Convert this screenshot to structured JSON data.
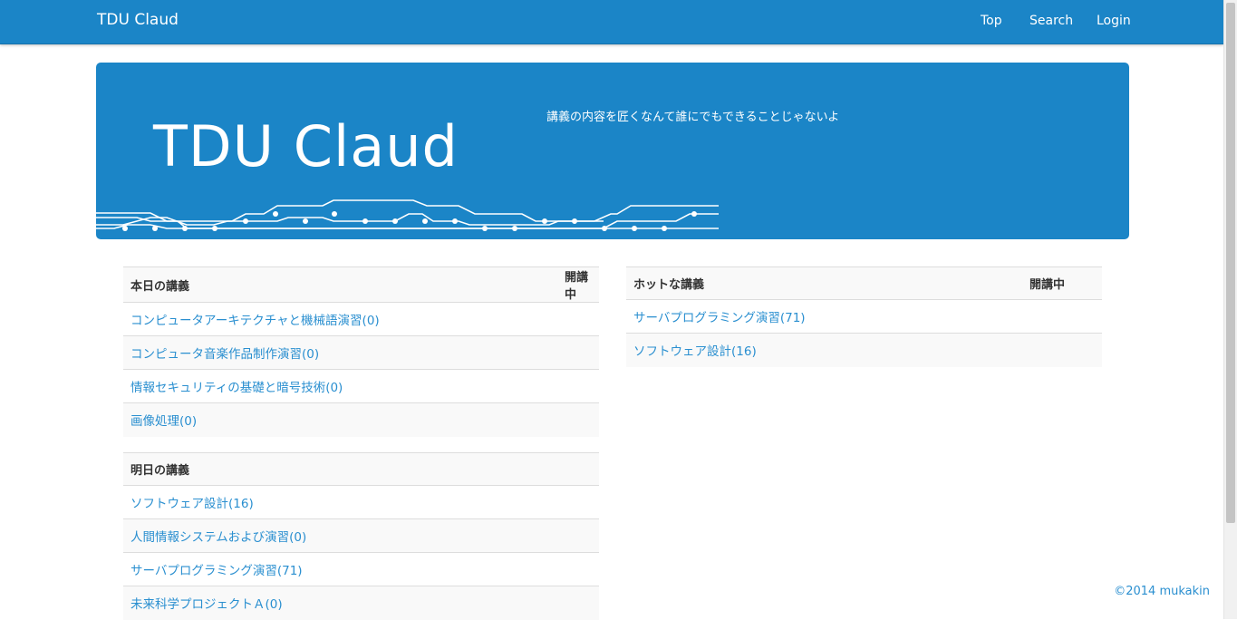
{
  "navbar": {
    "brand": "TDU Claud",
    "links": [
      "Top",
      "Search",
      "Login"
    ],
    "color": "#1b85c7"
  },
  "jumbotron": {
    "title": "TDU Claud",
    "tagline": "講義の内容を匠くなんて誰にでもできることじゃないよ"
  },
  "today": {
    "header": "本日の講義",
    "status_header": "開講中",
    "lectures": [
      "コンピュータアーキテクチャと機械語演習(0)",
      "コンピュータ音楽作品制作演習(0)",
      "情報セキュリティの基礎と暗号技術(0)",
      "画像処理(0)"
    ]
  },
  "hot": {
    "header": "ホットな講義",
    "status_header": "開講中",
    "lectures": [
      "サーバプログラミング演習(71)",
      "ソフトウェア設計(16)"
    ]
  },
  "tomorrow": {
    "header": "明日の講義",
    "lectures": [
      "ソフトウェア設計(16)",
      "人間情報システムおよび演習(0)",
      "サーバプログラミング演習(71)",
      "未来科学プロジェクトＡ(0)"
    ]
  },
  "footer": {
    "copyright": "©2014 mukakin"
  },
  "colors": {
    "link": "#2a8fd0",
    "primary": "#1b85c7"
  }
}
